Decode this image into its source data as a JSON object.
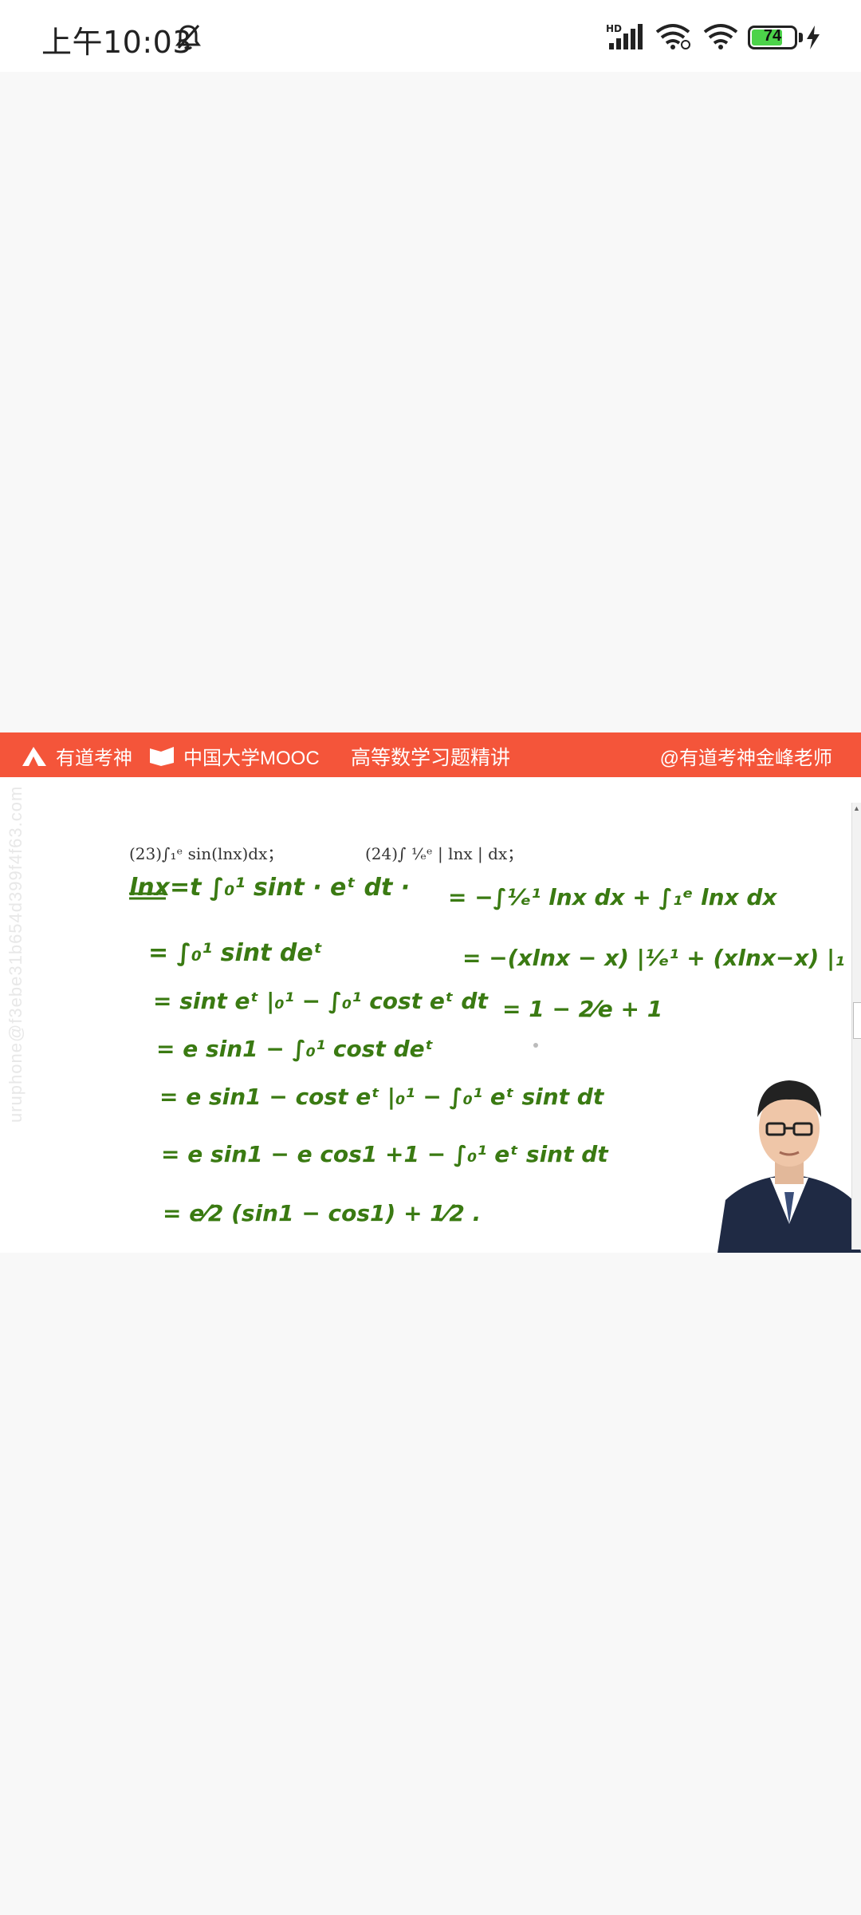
{
  "status_bar": {
    "time": "上午10:03",
    "battery": "74",
    "network_label": "HD"
  },
  "video": {
    "banner": {
      "logo_youdao": "有道考神",
      "logo_mooc": "中国大学MOOC",
      "course_title": "高等数学习题精讲",
      "teacher_handle": "@有道考神金峰老师"
    },
    "problems": {
      "p23": "(23)∫₁ᵉ sin(lnx)dx；",
      "p24": "(24)∫ ¹⁄ₑᵉ | lnx | dx；"
    },
    "watermark": "uruphone@f3ebe31b654d399f4f63.com",
    "left_solution": [
      "lnx=t  ∫₀¹ sint · eᵗ dt ·",
      "= ∫₀¹ sint deᵗ",
      "= sint eᵗ |₀¹ − ∫₀¹ cost eᵗ dt",
      "= e sin1 − ∫₀¹ cost deᵗ",
      "= e sin1 − cost eᵗ |₀¹ − ∫₀¹ eᵗ sint dt",
      "= e sin1 − e cos1 +1 − ∫₀¹ eᵗ sint dt",
      "= e⁄2 (sin1 − cos1) + 1⁄2 ."
    ],
    "right_solution": [
      "= −∫¹⁄ₑ¹ lnx dx + ∫₁ᵉ lnx dx",
      "= −(xlnx − x) |¹⁄ₑ¹ + (xlnx−x) |₁ᵉ",
      "= 1 − 2⁄e + 1"
    ]
  }
}
